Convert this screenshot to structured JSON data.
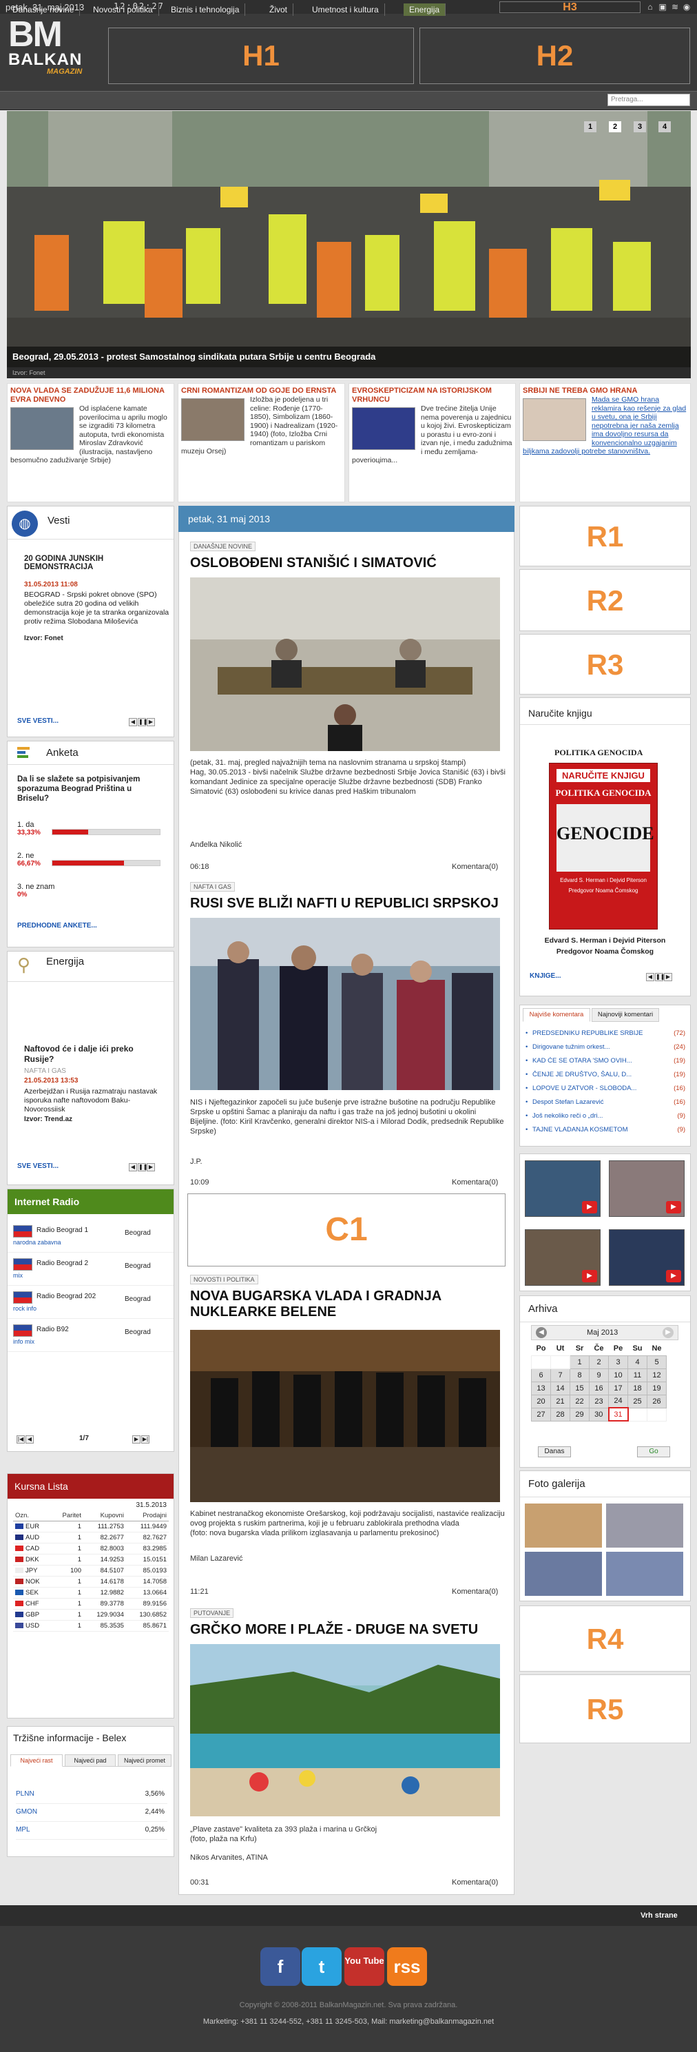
{
  "topbar": {
    "date": "petak, 31. maj 2013",
    "clock": "12:02:27",
    "h3": "H3"
  },
  "header": {
    "logo_bm": "BM",
    "logo_balkan": "BALKAN",
    "logo_magazin": "MAGAZIN",
    "h1": "H1",
    "h2": "H2"
  },
  "nav": {
    "items": [
      "Današnje novine",
      "Novosti i politika",
      "Biznis i tehnologija",
      "Život",
      "Umetnost i kultura",
      "Energija"
    ],
    "search_placeholder": "Pretraga..."
  },
  "slider": {
    "pages": [
      "1",
      "2",
      "3",
      "4"
    ],
    "active": "2",
    "caption": "Beograd, 29.05.2013 - protest Samostalnog sindikata putara Srbije u centru Beograda",
    "source": "Izvor: Fonet"
  },
  "teasers": [
    {
      "title": "NOVA VLADA SE ZADUŽUJE 11,6 MILIONA EVRA DNEVNO",
      "text": "Od isplaćene kamate poverilocima u aprilu moglo se izgraditi 73 kilometra autoputa, tvrdi ekonomista Miroslav Zdravković (ilustracija, nastavljeno besomučno zaduživanje Srbije)"
    },
    {
      "title": "CRNI ROMANTIZAM OD GOJE DO ERNSTA",
      "text": "Izložba je podeljena u tri celine: Rođenje (1770-1850), Simbolizam (1860-1900) i Nadrealizam (1920-1940) (foto, Izložba Crni romantizam u pariskom muzeju Orsej)"
    },
    {
      "title": "EVROSKEPTICIZAM NA ISTORIJSKOM VRHUNCU",
      "text": "Dve trećine žitelja Unije nema poverenja u zajednicu u kojoj živi. Evroskepticizam u porastu i u evro-zoni i izvan nje, i među zadužnima i među zemljama-poverioцima..."
    },
    {
      "title": "SRBIJI NE TREBA GMO HRANA",
      "text": "Mada se GMO hrana reklamira kao rešenje za glad u svetu, ona je Srbiji nepotrebna jer naša zemlja ima dovoljno resursa da konvencionalno uzgajanim biljkama zadovolji potrebe stanovništva."
    }
  ],
  "vesti": {
    "heading": "Vesti",
    "title": "20 GODINA JUNSKIH DEMONSTRACIJA",
    "date": "31.05.2013 11:08",
    "text": "BEOGRAD - Srpski pokret obnove (SPO) obeležiće sutra 20 godina od velikih demonstracija koje je ta stranka organizovala protiv režima Slobodana Miloševića",
    "source": "Izvor: Fonet",
    "more": "SVE VESTI..."
  },
  "anketa": {
    "heading": "Anketa",
    "question": "Da li se slažete sa potpisivanjem sporazuma Beograd Priština u Briselu?",
    "options": [
      {
        "label": "1. da",
        "pct": "33,33%",
        "value": 33.33
      },
      {
        "label": "2. ne",
        "pct": "66,67%",
        "value": 66.67
      },
      {
        "label": "3. ne znam",
        "pct": "0%",
        "value": 0
      }
    ],
    "prev": "PREDHODNE ANKETE..."
  },
  "energija": {
    "heading": "Energija",
    "title": "Naftovod će i dalje ići preko Rusije?",
    "cat": "NAFTA I GAS",
    "date": "21.05.2013 13:53",
    "text": "Azerbejdžan i Rusija razmatraju nastavak isporuka nafte naftovodom Baku-Novorossiisk",
    "source": "Izvor: Trend.az",
    "more": "SVE VESTI..."
  },
  "radio": {
    "heading": "Internet Radio",
    "stations": [
      {
        "name": "Radio Beograd 1",
        "genre": "narodna zabavna",
        "city": "Beograd"
      },
      {
        "name": "Radio Beograd 2",
        "genre": "mix",
        "city": "Beograd"
      },
      {
        "name": "Radio Beograd 202",
        "genre": "rock info",
        "city": "Beograd"
      },
      {
        "name": "Radio B92",
        "genre": "info mix",
        "city": "Beograd"
      }
    ],
    "page": "1/7"
  },
  "kursna": {
    "heading": "Kursna Lista",
    "date": "31.5.2013",
    "cols": [
      "Ozn.",
      "Paritet",
      "Kupovni",
      "Prodajni"
    ],
    "rows": [
      [
        "EUR",
        "1",
        "111.2753",
        "111.9449"
      ],
      [
        "AUD",
        "1",
        "82.2677",
        "82.7627"
      ],
      [
        "CAD",
        "1",
        "82.8003",
        "83.2985"
      ],
      [
        "DKK",
        "1",
        "14.9253",
        "15.0151"
      ],
      [
        "JPY",
        "100",
        "84.5107",
        "85.0193"
      ],
      [
        "NOK",
        "1",
        "14.6178",
        "14.7058"
      ],
      [
        "SEK",
        "1",
        "12.9882",
        "13.0664"
      ],
      [
        "CHF",
        "1",
        "89.3778",
        "89.9156"
      ],
      [
        "GBP",
        "1",
        "129.9034",
        "130.6852"
      ],
      [
        "USD",
        "1",
        "85.3535",
        "85.8671"
      ]
    ],
    "flag_colors": [
      "#1f3fa0",
      "#1f2f80",
      "#d22",
      "#c22",
      "#eee",
      "#b22",
      "#1a5ab0",
      "#d22",
      "#223a90",
      "#3a4a9a"
    ]
  },
  "belex": {
    "heading": "Tržišne informacije - Belex",
    "tabs": [
      "Najveći rast",
      "Najveći pad",
      "Najveći promet"
    ],
    "rows": [
      [
        "PLNN",
        "3,56%"
      ],
      [
        "GMON",
        "2,44%"
      ],
      [
        "MPL",
        "0,25%"
      ]
    ]
  },
  "center": {
    "date": "petak, 31 maj 2013",
    "c1": "C1",
    "articles": [
      {
        "cat": "DANAŠNJE NOVINE",
        "title": "OSLOBOĐENI STANIŠIĆ I SIMATOVIĆ",
        "text": "(petak, 31. maj, pregled najvažnijih tema na naslovnim stranama u srpskoj štampi)\nHag, 30.05.2013 - bivši načelnik Službe državne bezbednosti Srbije Jovica Stanišić (63) i bivši komandant Jedinice za specijalne operacije Službe državne bezbednosti (SDB) Franko Simatović (63) oslobođeni su krivice danas pred Haškim tribunalom",
        "author": "Anđelka Nikolić",
        "time": "06:18",
        "comments": "Komentara(0)"
      },
      {
        "cat": "NAFTA I GAS",
        "title": "RUSI SVE BLIŽI NAFTI U REPUBLICI SRPSKOJ",
        "text": "NIS i Njeftegazinkor započeli su jučе bušenje prve istražne bušotine na području Republike Srpske u opštini Šamac a planiraju da naftu i gas traže na još jednoj bušotini u okolini Bijeljine. (foto: Kiril Kravčenko, generalni direktor NIS-a i Milorad Dodik, predsednik Republike Srpske)",
        "author": "J.P.",
        "time": "10:09",
        "comments": "Komentara(0)"
      },
      {
        "cat": "NOVOSTI I POLITIKA",
        "title": "NOVA BUGARSKA VLADA I GRADNJA NUKLEARKE BELENE",
        "text": "Kabinet nestranačkog ekonomiste Orešarskog, koji podržavaju socijalisti, nastaviće realizaciju ovog projekta s ruskim partnerima, koji je u februaru zablokirala prethodna vlada\n(foto: nova bugarska vlada prilikom izglasavanja u parlamentu prekosinoć)",
        "author": "Milan Lazarević",
        "time": "11:21",
        "comments": "Komentara(0)"
      },
      {
        "cat": "PUTOVANJE",
        "title": "GRČKO MORE I PLAŽE - DRUGE NA SVETU",
        "text": "„Plave zastave\" kvaliteta za 393 plaža i marina u Grčkoj\n(foto, plaža na Krfu)",
        "author": "Nikos Arvanites, ATINA",
        "time": "00:31",
        "comments": "Komentara(0)"
      }
    ]
  },
  "right": {
    "r1": "R1",
    "r2": "R2",
    "r3": "R3",
    "r4": "R4",
    "r5": "R5",
    "knjiga": {
      "heading": "Naručite knjigu",
      "cover_top": "POLITIKA GENOCIDA",
      "cover_banner": "NARUČITE KNJIGU",
      "cover_sub": "POLITIKA GENOCIDA",
      "cover_word": "GENOCIDE",
      "cover_authors": "Edvard S. Herman i Dejvid Piterson",
      "cover_pred": "Predgovor Noama Čomskog",
      "caption1": "Edvard S. Herman i Dejvid Piterson",
      "caption2": "Predgovor Noama Čomskog",
      "more": "KNJIGE..."
    },
    "komentari": {
      "tabs": [
        "Najviše komentara",
        "Najnoviji komentari"
      ],
      "items": [
        [
          "PREDSEDNIKU REPUBLIKE SRBIJE",
          "(72)"
        ],
        [
          "Dirigovane tužnim orkest...",
          "(24)"
        ],
        [
          "KAD ĆE SE OTARA 'SMO OVIH...",
          "(19)"
        ],
        [
          "ČENJE JE DRUŠTVO, ŠALU, D...",
          "(19)"
        ],
        [
          "LOPOVE U ZATVOR - SLOBODA...",
          "(16)"
        ],
        [
          "Despot Stefan Lazarević",
          "(16)"
        ],
        [
          "Još nekoliko reči o „dri...",
          "(9)"
        ],
        [
          "TAJNE VLADANJA KOSMETOM",
          "(9)"
        ]
      ]
    },
    "arhiva": {
      "heading": "Arhiva",
      "month": "Maj 2013",
      "days": [
        "Po",
        "Ut",
        "Sr",
        "Če",
        "Pe",
        "Su",
        "Ne"
      ],
      "weeks": [
        [
          "",
          "",
          "1",
          "2",
          "3",
          "4",
          "5"
        ],
        [
          "6",
          "7",
          "8",
          "9",
          "10",
          "11",
          "12"
        ],
        [
          "13",
          "14",
          "15",
          "16",
          "17",
          "18",
          "19"
        ],
        [
          "20",
          "21",
          "22",
          "23",
          "24",
          "25",
          "26"
        ],
        [
          "27",
          "28",
          "29",
          "30",
          "31",
          "",
          ""
        ]
      ],
      "today": "31",
      "today_btn": "Danas",
      "go_btn": "Go"
    },
    "galerija": {
      "heading": "Foto galerija"
    }
  },
  "footer": {
    "top_link": "Vrh strane",
    "copyright": "Copyright © 2008-2011 BalkanMagazin.net. Sva prava zadržana.",
    "contact": "Marketing: +381 11 3244-552, +381 11 3245-503, Mail: marketing@balkanmagazin.net",
    "social": [
      "f",
      "t",
      "You Tube",
      "rss"
    ],
    "social_colors": [
      "#3b5998",
      "#2aa3e0",
      "#c4302b",
      "#f07b1c"
    ]
  },
  "colors": {
    "accent": "#f0913c",
    "headline_red": "#c23a1a",
    "radio_green": "#4f8a1c",
    "kursna_red": "#a61b1b",
    "center_blue": "#4a87b5"
  }
}
